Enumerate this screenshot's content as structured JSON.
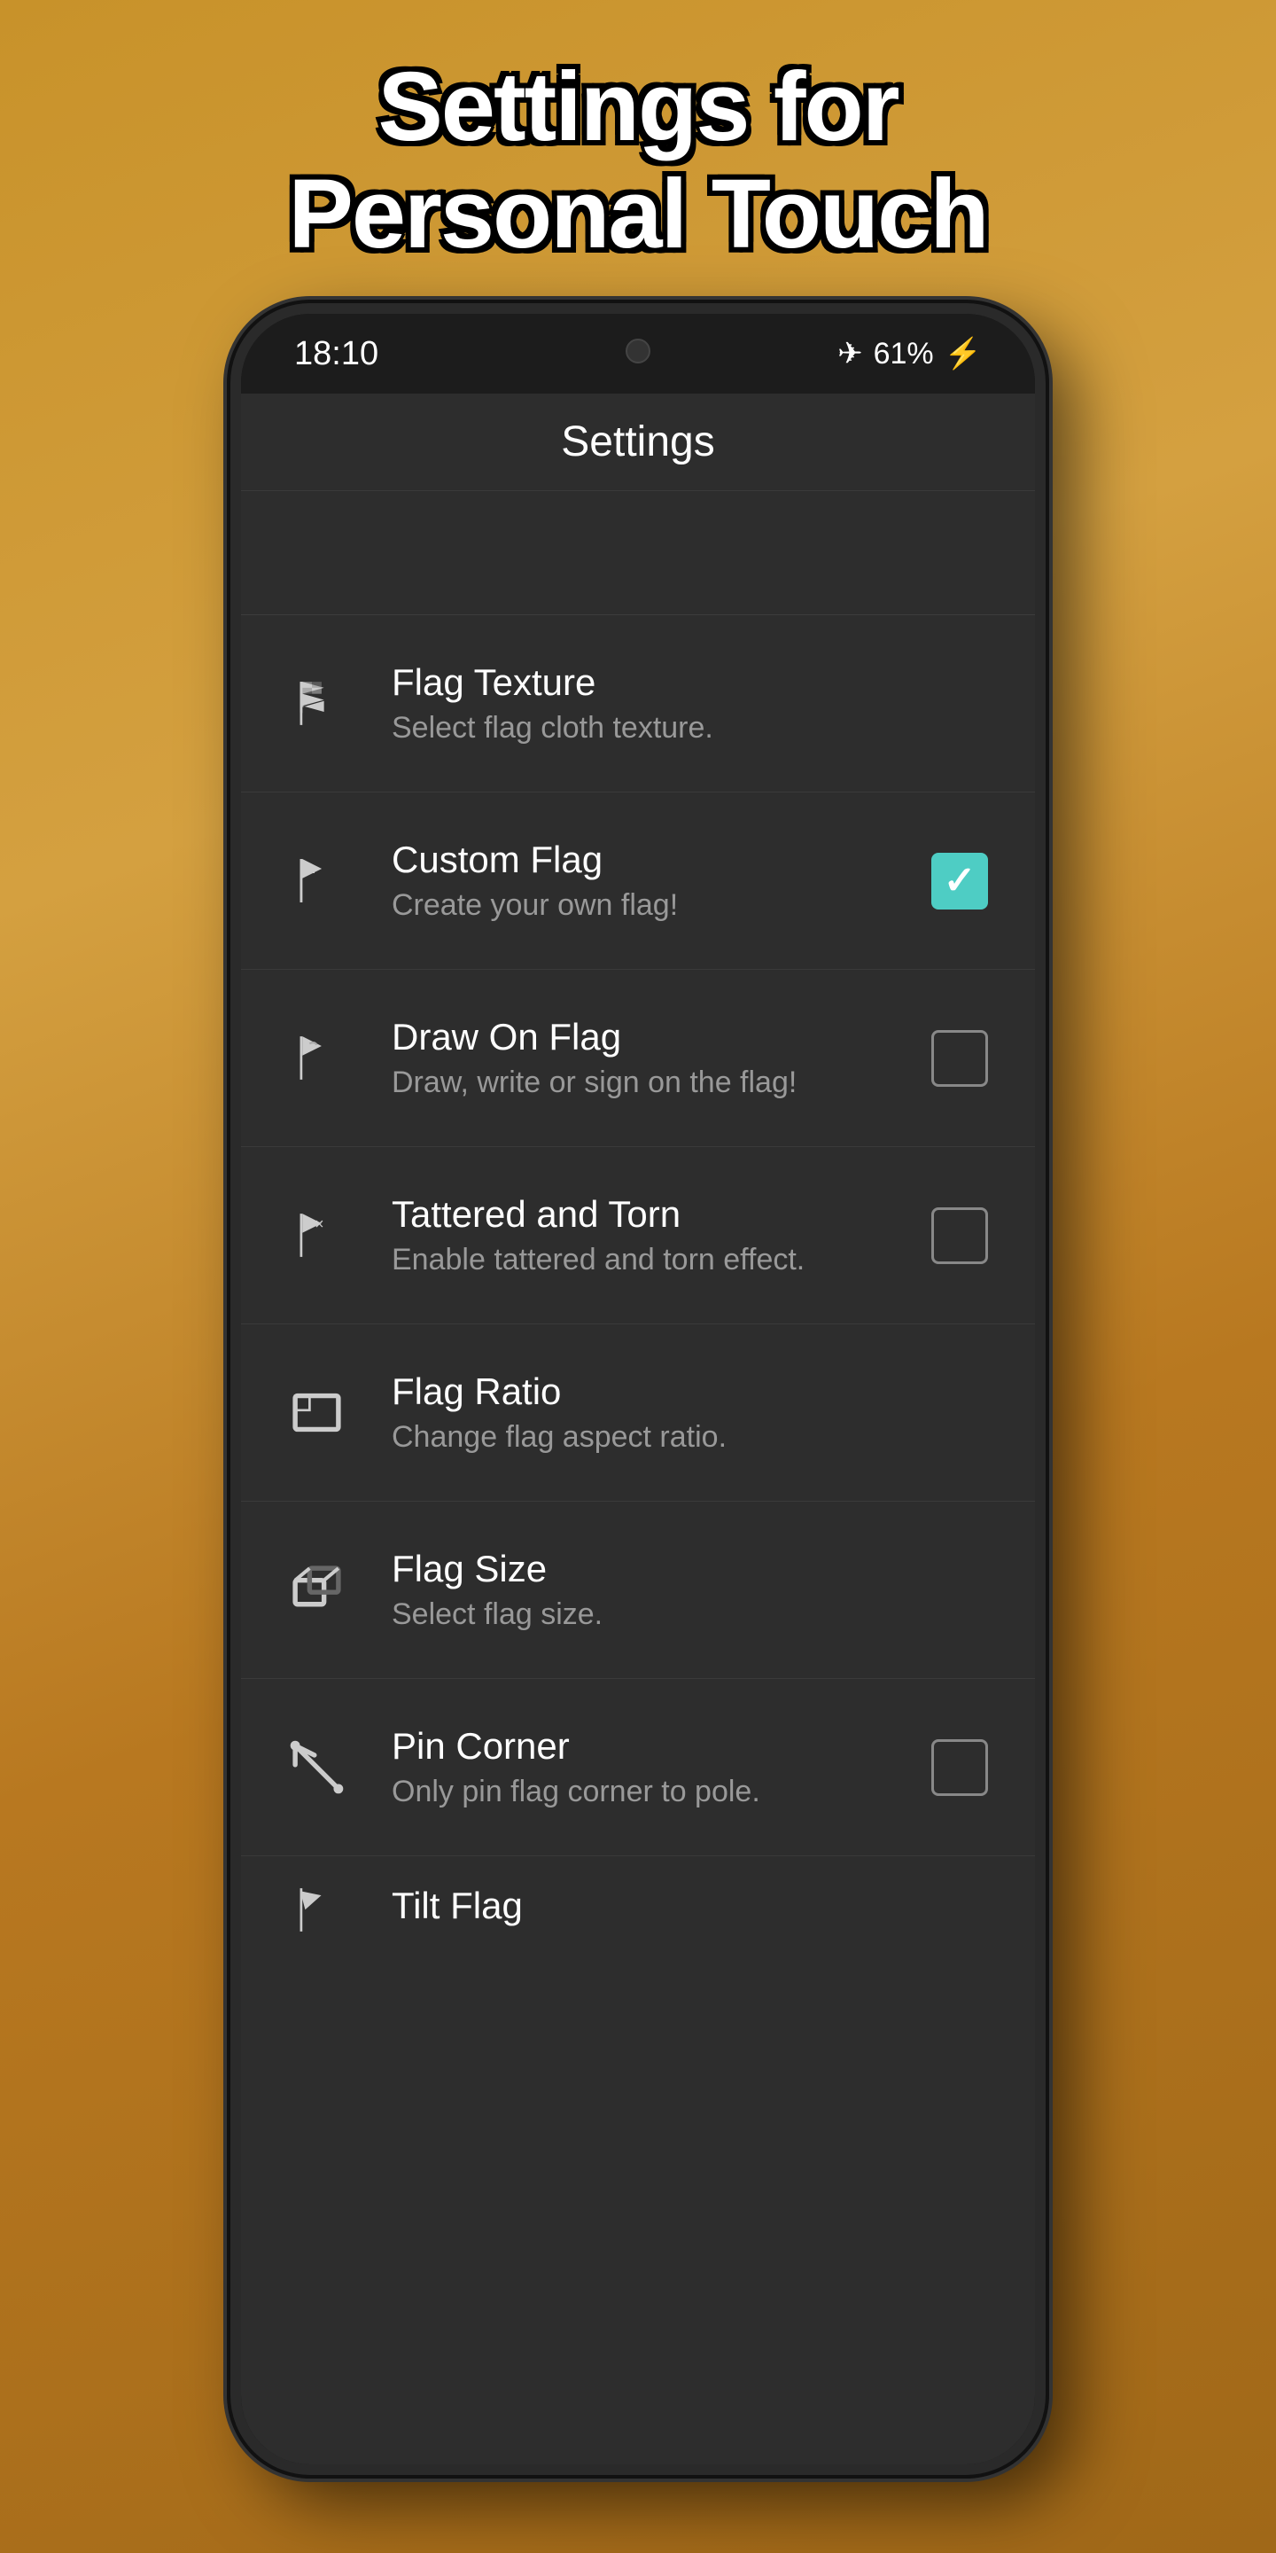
{
  "page": {
    "title_line1": "Settings for",
    "title_line2": "Personal Touch"
  },
  "status_bar": {
    "time": "18:10",
    "battery": "61%",
    "signal": "✈"
  },
  "app_bar": {
    "title": "Settings"
  },
  "settings_items": [
    {
      "id": "flag-texture",
      "title": "Flag Texture",
      "subtitle": "Select flag cloth texture.",
      "icon": "flag-texture-icon",
      "control": "none"
    },
    {
      "id": "custom-flag",
      "title": "Custom Flag",
      "subtitle": "Create your own flag!",
      "icon": "custom-flag-icon",
      "control": "checkbox-checked"
    },
    {
      "id": "draw-on-flag",
      "title": "Draw On Flag",
      "subtitle": "Draw, write or sign on the flag!",
      "icon": "draw-flag-icon",
      "control": "checkbox-unchecked"
    },
    {
      "id": "tattered-torn",
      "title": "Tattered and Torn",
      "subtitle": "Enable tattered and torn effect.",
      "icon": "tattered-icon",
      "control": "checkbox-unchecked"
    },
    {
      "id": "flag-ratio",
      "title": "Flag Ratio",
      "subtitle": "Change flag aspect ratio.",
      "icon": "ratio-icon",
      "control": "none"
    },
    {
      "id": "flag-size",
      "title": "Flag Size",
      "subtitle": "Select flag size.",
      "icon": "size-icon",
      "control": "none"
    },
    {
      "id": "pin-corner",
      "title": "Pin Corner",
      "subtitle": "Only pin flag corner to pole.",
      "icon": "pin-icon",
      "control": "checkbox-unchecked"
    },
    {
      "id": "tilt-flag",
      "title": "Tilt Flag",
      "subtitle": "",
      "icon": "tilt-icon",
      "control": "none"
    }
  ]
}
